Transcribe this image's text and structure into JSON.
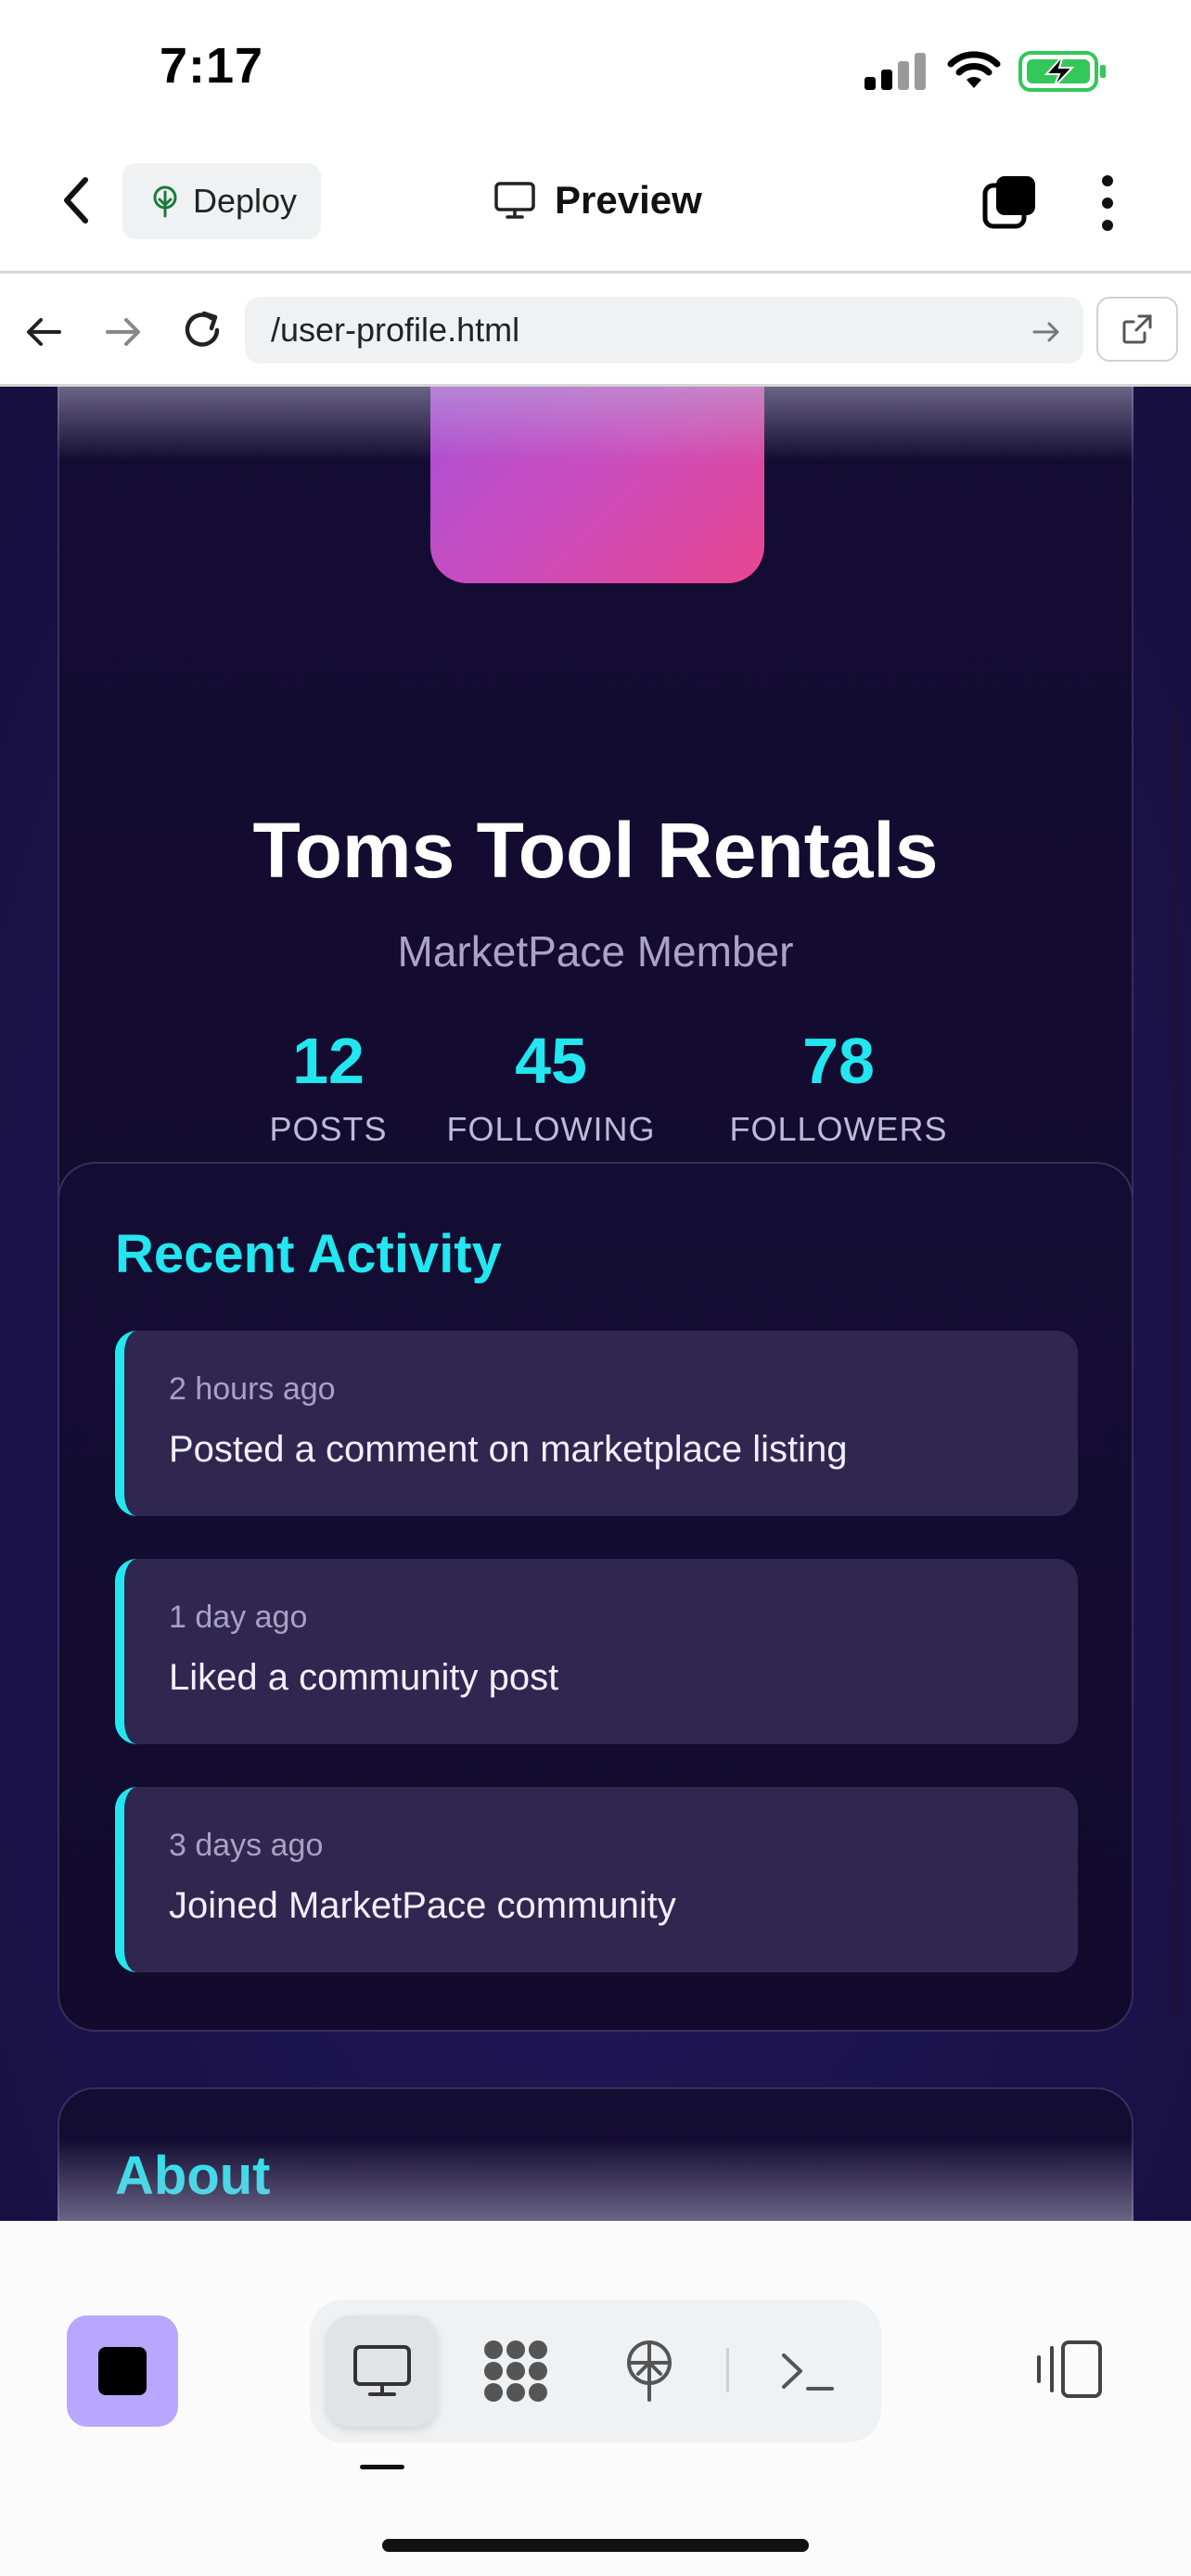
{
  "status": {
    "time": "7:17"
  },
  "toolbar": {
    "deploy_label": "Deploy",
    "preview_label": "Preview"
  },
  "browser": {
    "url": "/user-profile.html"
  },
  "profile": {
    "name": "Toms Tool Rentals",
    "subtitle": "MarketPace Member",
    "stats": [
      {
        "value": "12",
        "label": "POSTS"
      },
      {
        "value": "45",
        "label": "FOLLOWING"
      },
      {
        "value": "78",
        "label": "FOLLOWERS"
      }
    ]
  },
  "activity": {
    "title": "Recent Activity",
    "items": [
      {
        "time": "2 hours ago",
        "text": "Posted a comment on marketplace listing"
      },
      {
        "time": "1 day ago",
        "text": "Liked a community post"
      },
      {
        "time": "3 days ago",
        "text": "Joined MarketPace community"
      }
    ]
  },
  "about": {
    "title": "About"
  },
  "colors": {
    "accent": "#22e6f0",
    "stop_button": "#b9a7ff",
    "battery": "#34c759"
  }
}
